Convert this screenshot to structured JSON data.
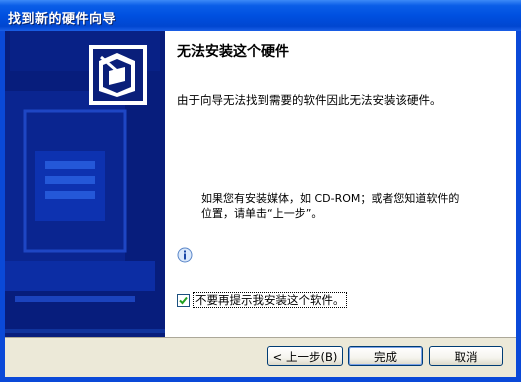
{
  "window": {
    "title": "找到新的硬件向导"
  },
  "content": {
    "heading": "无法安装这个硬件",
    "description": "由于向导无法找到需要的软件因此无法安装该硬件。",
    "hint": "如果您有安装媒体，如 CD-ROM；或者您知道软件的\n位置，请单击“上一步”。",
    "info_icon": "info-icon",
    "checkbox": {
      "label": "不要再提示我安装这个软件。",
      "checked": true
    }
  },
  "buttons": {
    "back": "< 上一步(B)",
    "finish": "完成",
    "cancel": "取消"
  },
  "colors": {
    "titlebar": "#0050e0",
    "sidepanel": "#071d7c",
    "button_face": "#ece9d8"
  }
}
